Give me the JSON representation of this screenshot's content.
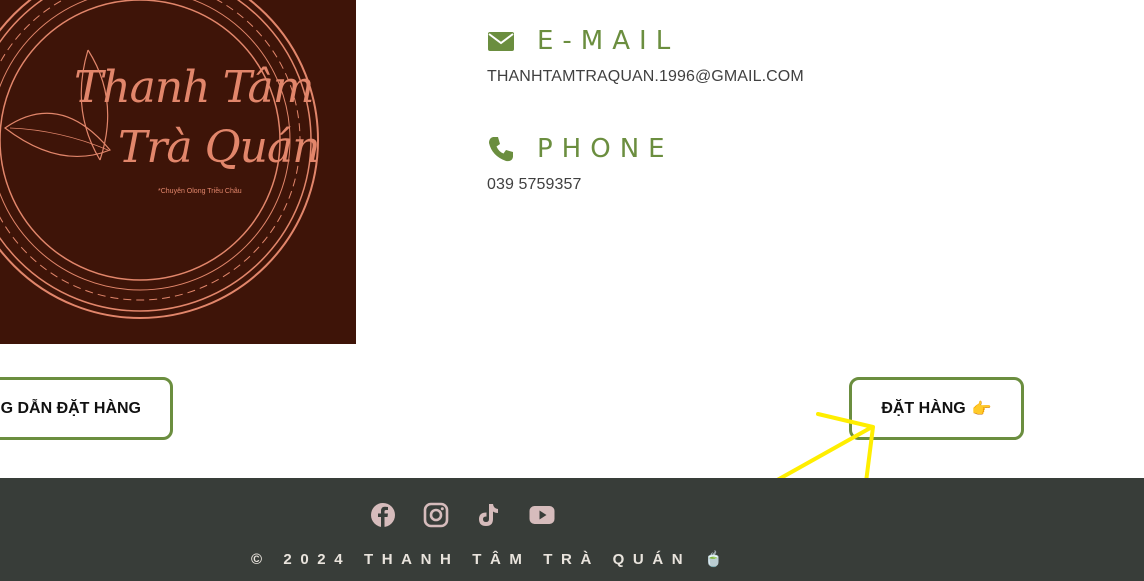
{
  "logo": {
    "line1": "Thanh Tâm",
    "line2": "Trà Quán",
    "tagline": "*Chuyên Olong Triều Châu"
  },
  "contact": {
    "email": {
      "title": "E-MAIL",
      "value": "THANHTAMTRAQUAN.1996@GMAIL.COM",
      "icon": "envelope-icon"
    },
    "phone": {
      "title": "PHONE",
      "value": "039 5759357",
      "icon": "phone-icon"
    }
  },
  "buttons": {
    "guide_label": "G DẪN ĐẶT HÀNG",
    "order_label": "ĐẶT HÀNG",
    "order_emoji": "👉"
  },
  "footer": {
    "social": [
      "facebook-icon",
      "instagram-icon",
      "tiktok-icon",
      "youtube-icon"
    ],
    "copyright": "© 2024 THANH TÂM TRÀ QUÁN 🍵"
  },
  "colors": {
    "accent_green": "#6b8e3f",
    "logo_bg": "#3e1408",
    "logo_fg": "#e2866b",
    "footer_bg": "#383d39",
    "social_icon": "#d6bcbc",
    "annotation_arrow": "#ffee00"
  }
}
